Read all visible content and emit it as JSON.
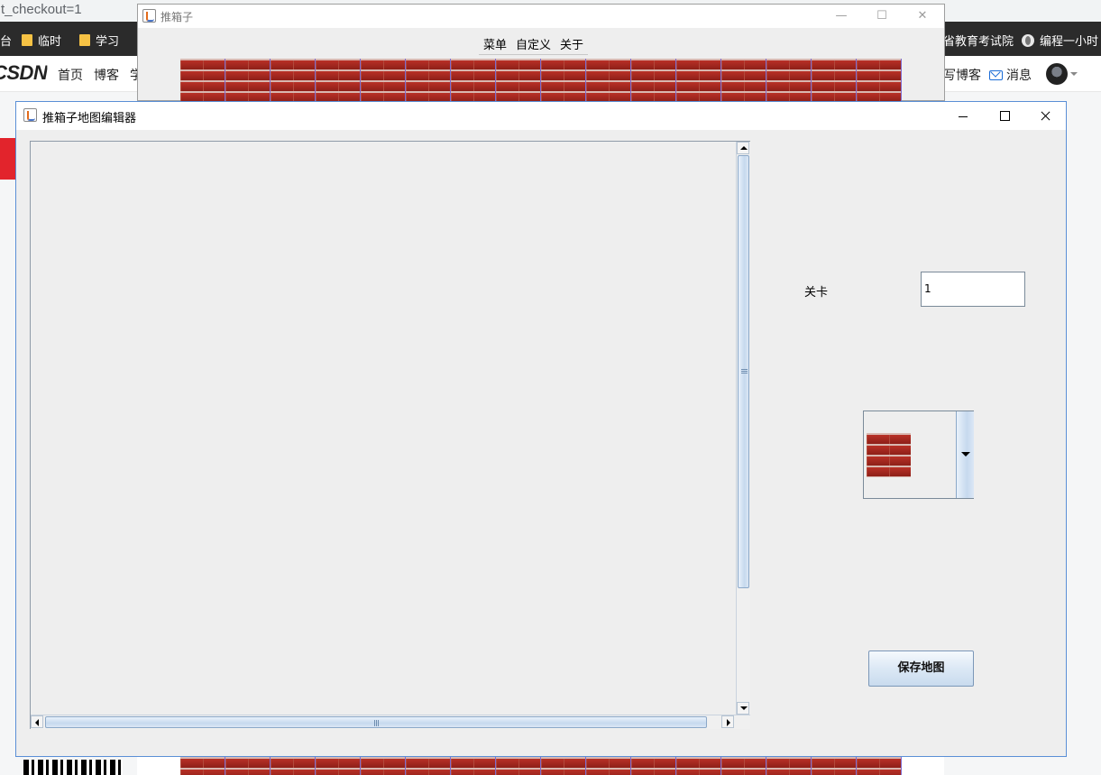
{
  "browser": {
    "url_fragment": "t_checkout=1",
    "bookmarks": [
      {
        "label": "台"
      },
      {
        "label": "临时"
      },
      {
        "label": "学习"
      }
    ],
    "bookmarks_right": [
      "省教育考试院",
      "编程一小时"
    ],
    "csdn": {
      "logo": "CSDN",
      "nav": [
        "首页",
        "博客",
        "学"
      ],
      "nav_right": [
        "写博客",
        "消息"
      ]
    }
  },
  "game_window": {
    "title": "推箱子",
    "menu": [
      "菜单",
      "自定义",
      "关于"
    ]
  },
  "editor": {
    "title": "推箱子地图编辑器",
    "level_label": "关卡",
    "level_value": "1",
    "tile_selected": "brick-wall",
    "save_label": "保存地图"
  },
  "colors": {
    "window_bg": "#eeeeee",
    "brick": "#a8291f",
    "accent_border": "#5a8fd6"
  }
}
